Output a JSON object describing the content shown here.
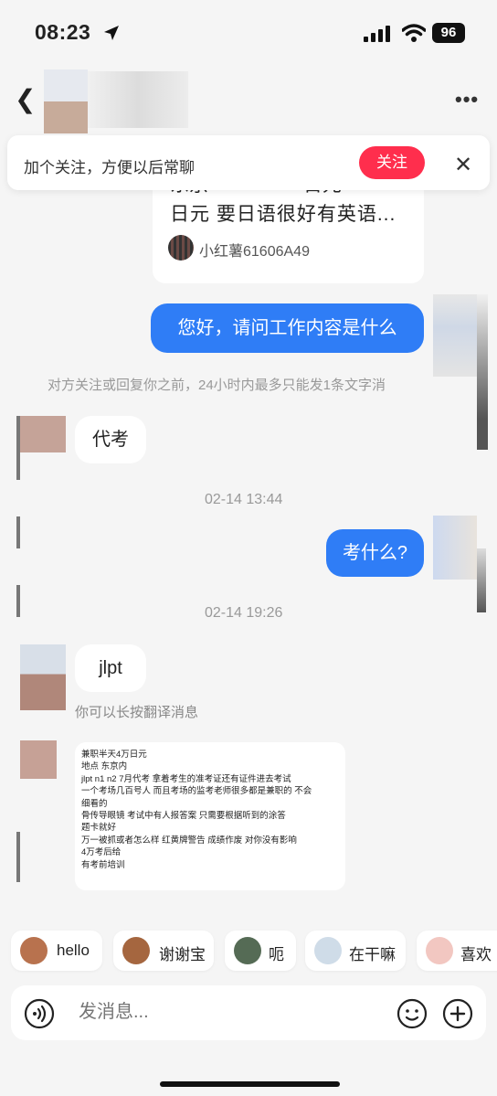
{
  "status_bar": {
    "time": "08:23",
    "battery": "96"
  },
  "follow_banner": {
    "text": "加个关注，方便以后常聊",
    "button": "关注",
    "close": "✕"
  },
  "card": {
    "title_line1": "东京 ･ ･ ･ ･ ･ ･ 日元",
    "title_line2": "日元 要日语很好有英语...",
    "user": "小红薯61606A49"
  },
  "messages": {
    "m1": "您好，请问工作内容是什么",
    "system_notice": "对方关注或回复你之前，24小时内最多只能发1条文字消",
    "m2": "代考",
    "time1": "02-14 13:44",
    "m3": "考什么?",
    "time2": "02-14 19:26",
    "m4": "jlpt",
    "translate_hint": "你可以长按翻译消息"
  },
  "note_lines": [
    "兼职半天4万日元",
    "地点 东京内",
    "jlpt n1 n2 7月代考 拿着考生的准考证还有证件进去考试",
    "一个考场几百号人 而且考场的监考老师很多都是兼职的 不会",
    "细看的",
    "骨传导眼镜 考试中有人报答案 只需要根据听到的涂答",
    "题卡就好",
    "万一被抓或者怎么样 红黄牌警告 成绩作废 对你没有影响",
    "4万考后给",
    "有考前培训"
  ],
  "quick_replies": [
    "hello",
    "谢谢宝",
    "呃",
    "在干嘛",
    "喜欢"
  ],
  "input": {
    "placeholder": "发消息..."
  },
  "colors": {
    "accent_blue": "#2f7df6",
    "follow_red": "#ff2e4d"
  },
  "icons": [
    "location-arrow-icon",
    "signal-icon",
    "wifi-icon",
    "back-icon",
    "more-icon",
    "close-icon",
    "voice-icon",
    "emoji-icon",
    "plus-icon"
  ]
}
